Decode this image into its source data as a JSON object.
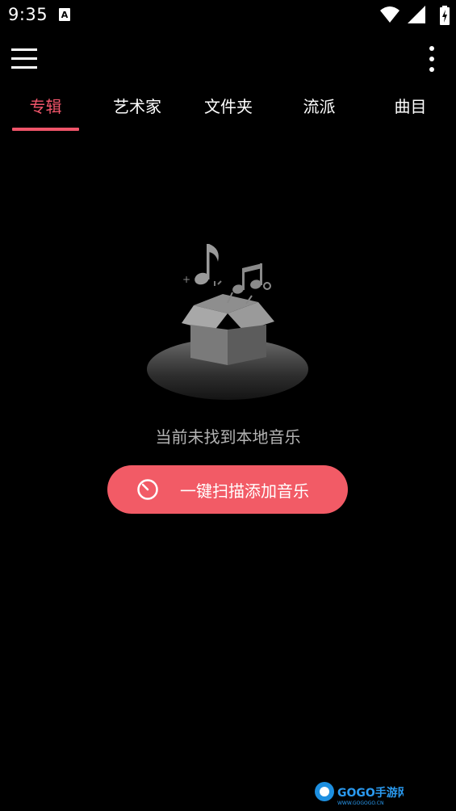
{
  "status_bar": {
    "time": "9:35",
    "notification_icon": "a-letter-icon",
    "wifi_icon": "wifi-icon",
    "signal_icon": "signal-icon",
    "battery_icon": "battery-charging-icon"
  },
  "app_bar": {
    "menu_icon": "hamburger-menu-icon",
    "more_icon": "more-vertical-icon"
  },
  "tabs": [
    {
      "label": "专辑",
      "active": true
    },
    {
      "label": "艺术家",
      "active": false
    },
    {
      "label": "文件夹",
      "active": false
    },
    {
      "label": "流派",
      "active": false
    },
    {
      "label": "曲目",
      "active": false
    }
  ],
  "empty_state": {
    "illustration": "music-box-empty-icon",
    "message": "当前未找到本地音乐",
    "button_label": "一键扫描添加音乐",
    "button_icon": "scan-timer-icon"
  },
  "colors": {
    "accent": "#f0556a",
    "button": "#f25b66",
    "background": "#000000",
    "muted_text": "#b3b3b3"
  },
  "watermark": {
    "text": "GOGO手游网"
  }
}
